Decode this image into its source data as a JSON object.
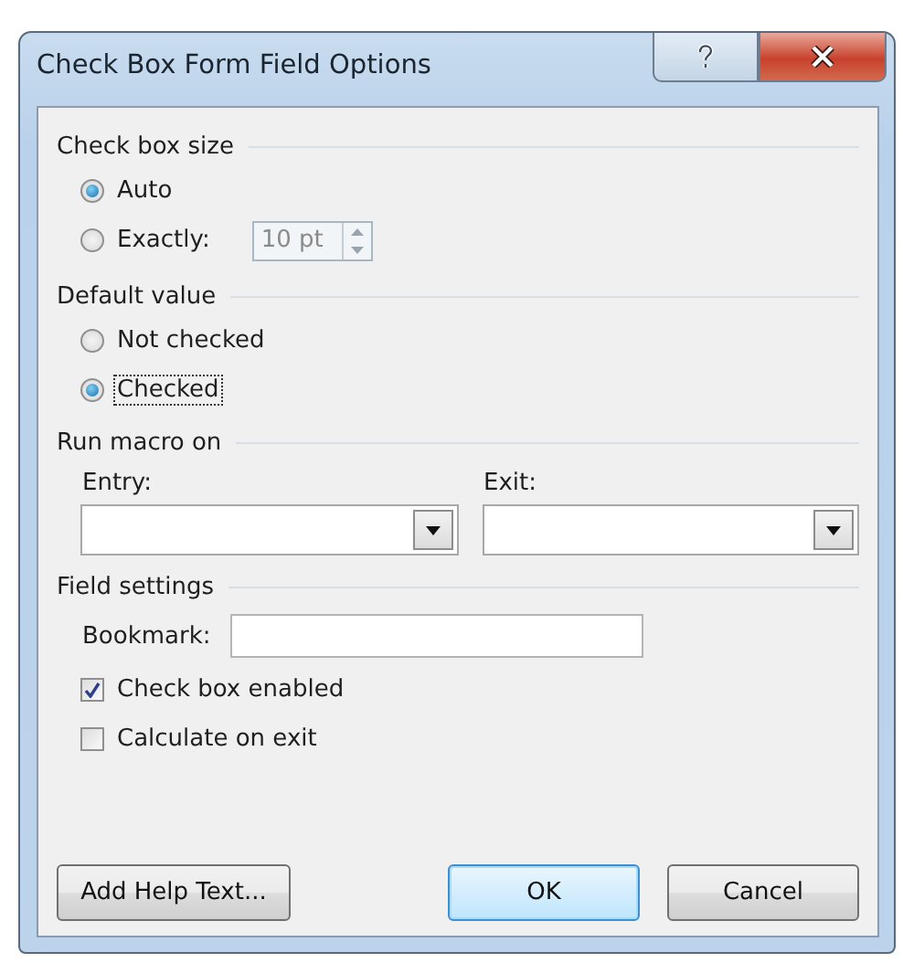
{
  "window": {
    "title": "Check Box Form Field Options"
  },
  "check_box_size": {
    "heading": "Check box size",
    "options": [
      {
        "label": "Auto",
        "selected": true,
        "focused": false
      },
      {
        "label": "Exactly:",
        "selected": false,
        "focused": false
      }
    ],
    "size_field": {
      "value": "10 pt",
      "disabled": true
    }
  },
  "default_value": {
    "heading": "Default value",
    "options": [
      {
        "label": "Not checked",
        "selected": false,
        "focused": false
      },
      {
        "label": "Checked",
        "selected": true,
        "focused": true
      }
    ]
  },
  "run_macro_on": {
    "heading": "Run macro on",
    "entry": {
      "label": "Entry:"
    },
    "exit": {
      "label": "Exit:"
    }
  },
  "field_settings": {
    "heading": "Field settings",
    "bookmark": {
      "label": "Bookmark:"
    },
    "checkboxes": [
      {
        "label": "Check box enabled",
        "checked": true
      },
      {
        "label": "Calculate on exit",
        "checked": false
      }
    ]
  },
  "buttons": [
    {
      "label": "Add Help Text...",
      "default": false
    },
    {
      "label": "OK",
      "default": true
    },
    {
      "label": "Cancel",
      "default": false
    }
  ]
}
